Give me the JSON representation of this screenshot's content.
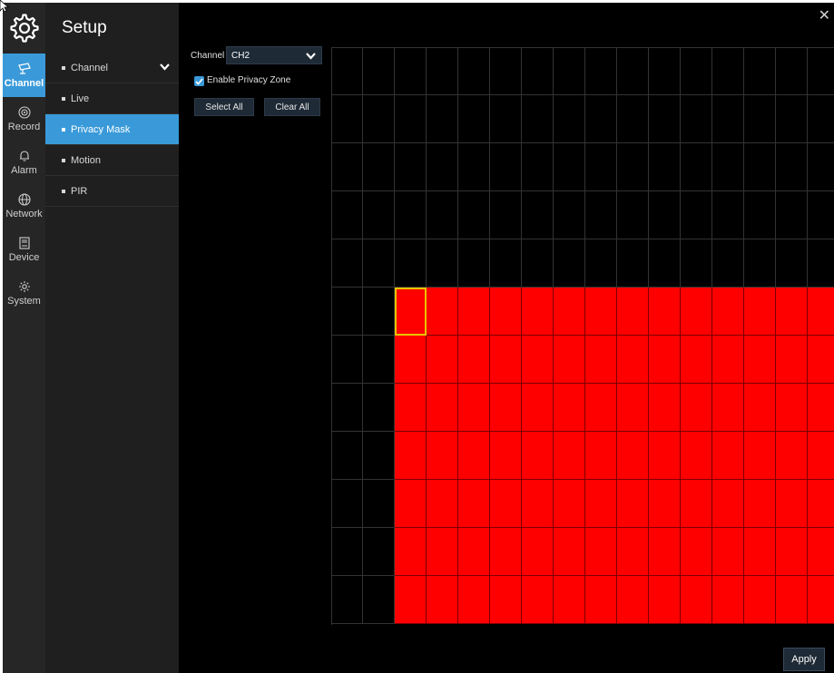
{
  "app": {
    "title": "Setup"
  },
  "rail": {
    "items": [
      {
        "label": "Channel",
        "icon": "camera-icon",
        "active": true
      },
      {
        "label": "Record",
        "icon": "record-icon",
        "active": false
      },
      {
        "label": "Alarm",
        "icon": "bell-icon",
        "active": false
      },
      {
        "label": "Network",
        "icon": "globe-icon",
        "active": false
      },
      {
        "label": "Device",
        "icon": "hdd-icon",
        "active": false
      },
      {
        "label": "System",
        "icon": "gear-icon",
        "active": false
      }
    ]
  },
  "submenu": {
    "items": [
      {
        "label": "Channel",
        "expanded": true,
        "active": false
      },
      {
        "label": "Live",
        "active": false
      },
      {
        "label": "Privacy Mask",
        "active": true
      },
      {
        "label": "Motion",
        "active": false
      },
      {
        "label": "PIR",
        "active": false
      }
    ]
  },
  "controls": {
    "channel_label": "Channel",
    "channel_value": "CH2",
    "enable_label": "Enable Privacy Zone",
    "enable_checked": true,
    "select_all": "Select All",
    "clear_all": "Clear All",
    "apply": "Apply"
  },
  "mask_grid": {
    "columns": 16,
    "rows": 12,
    "masked_from_row": 5,
    "masked_from_col": 2,
    "selected_cell": {
      "row": 5,
      "col": 2
    }
  },
  "colors": {
    "accent": "#3a9ad9",
    "mask": "#ff0000",
    "selection": "#e8c400"
  }
}
